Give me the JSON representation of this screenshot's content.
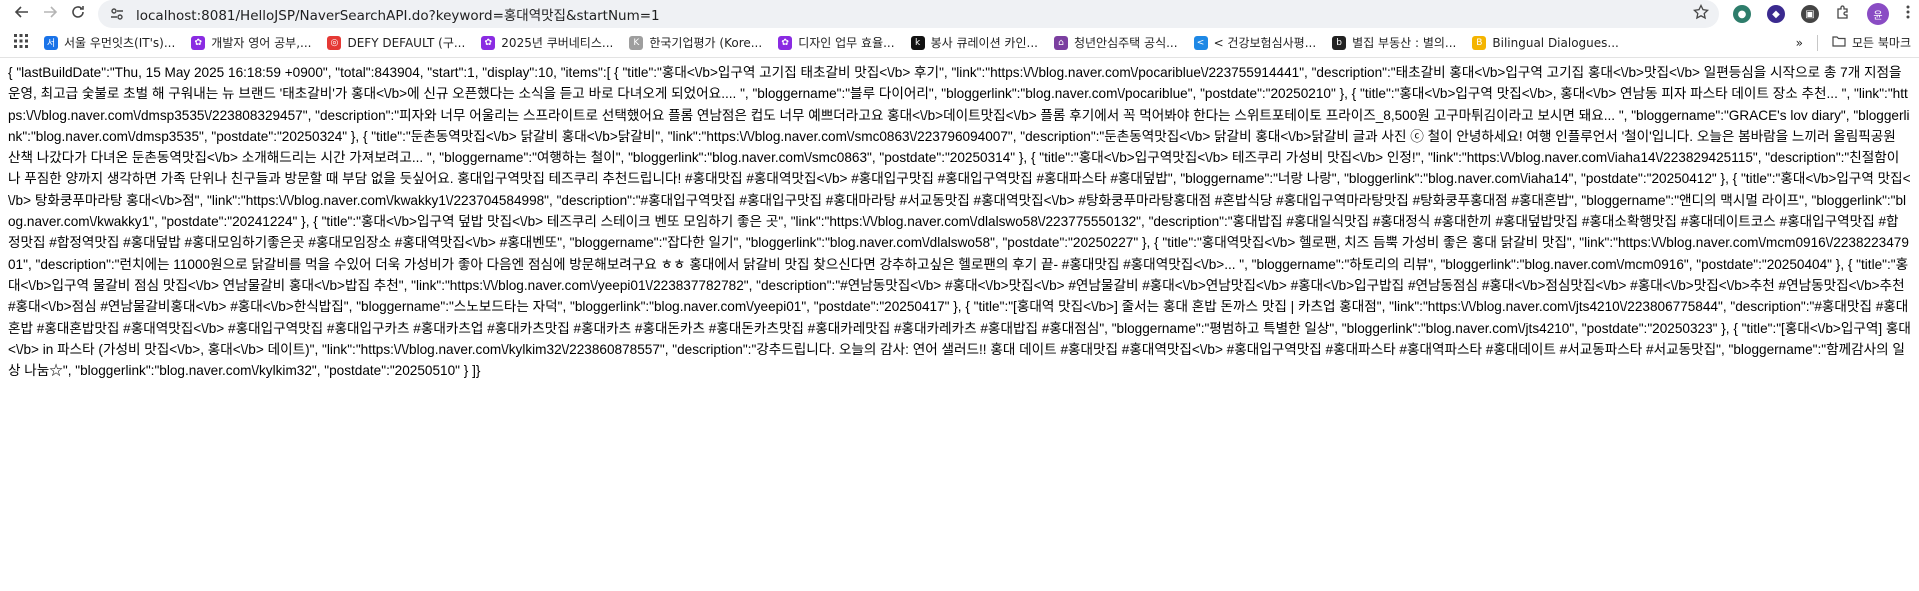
{
  "browser": {
    "url": "localhost:8081/HelloJSP/NaverSearchAPI.do?keyword=홍대역맛집&startNum=1",
    "profile_initial": "윤"
  },
  "bookmarks": [
    {
      "label": "서울 우먼잇츠(IT's)...",
      "icon_color": "#1a73e8",
      "icon": "서"
    },
    {
      "label": "개발자 영어 공부,...",
      "icon_color": "#8a2be2",
      "icon": "✿"
    },
    {
      "label": "DEFY DEFAULT (구...",
      "icon_color": "#e53935",
      "icon": "◎"
    },
    {
      "label": "2025년 쿠버네티스...",
      "icon_color": "#8a2be2",
      "icon": "✿"
    },
    {
      "label": "한국기업평가 (Kore...",
      "icon_color": "#9e9e9e",
      "icon": "K"
    },
    {
      "label": "디자인 업무 효율...",
      "icon_color": "#8a2be2",
      "icon": "✿"
    },
    {
      "label": "봉사 큐레이션 카인...",
      "icon_color": "#111111",
      "icon": "k"
    },
    {
      "label": "청년안심주택 공식...",
      "icon_color": "#7b3fa0",
      "icon": "⌂"
    },
    {
      "label": "< 건강보험심사평...",
      "icon_color": "#1e88e5",
      "icon": "<"
    },
    {
      "label": "별집 부동산 : 별의...",
      "icon_color": "#222222",
      "icon": "b"
    },
    {
      "label": "Bilingual Dialogues...",
      "icon_color": "#f4b400",
      "icon": "B"
    }
  ],
  "bookmarks_folder": "모든 북마크",
  "json_text": "{ \"lastBuildDate\":\"Thu, 15 May 2025 16:18:59 +0900\", \"total\":843904, \"start\":1, \"display\":10, \"items\":[ { \"title\":\"홍대<\\/b>입구역 고기집 태초갈비 맛집<\\/b> 후기\", \"link\":\"https:\\/\\/blog.naver.com\\/pocariblue\\/223755914441\", \"description\":\"태초갈비 홍대<\\/b>입구역 고기집 홍대<\\/b>맛집<\\/b> 일편등심을 시작으로 총 7개 지점을 운영, 최고급 숯불로 초벌 해 구워내는 뉴 브랜드 '태초갈비'가 홍대<\\/b>에 신규 오픈했다는 소식을 듣고 바로 다녀오게 되었어요.... \", \"bloggername\":\"블루 다이어리\", \"bloggerlink\":\"blog.naver.com\\/pocariblue\", \"postdate\":\"20250210\" }, { \"title\":\"홍대<\\/b>입구역 맛집<\\/b>, 홍대<\\/b> 연남동 피자 파스타 데이트 장소 추천... \", \"link\":\"https:\\/\\/blog.naver.com\\/dmsp3535\\/223808329457\", \"description\":\"피자와 너무 어울리는 스프라이트로 선택했어요 플롬 연남점은 컵도 너무 예쁘더라고요 홍대<\\/b>데이트맛집<\\/b> 플롬 후기에서 꼭 먹어봐야 한다는 스위트포테이토 프라이즈_8,500원 고구마튀김이라고 보시면 돼요... \", \"bloggername\":\"GRACE's lov diary\", \"bloggerlink\":\"blog.naver.com\\/dmsp3535\", \"postdate\":\"20250324\" }, { \"title\":\"둔촌동역맛집<\\/b> 닭갈비 홍대<\\/b>닭갈비\", \"link\":\"https:\\/\\/blog.naver.com\\/smc0863\\/223796094007\", \"description\":\"둔촌동역맛집<\\/b> 닭갈비 홍대<\\/b>닭갈비 글과 사진 ⓒ 철이 안녕하세요! 여행 인플루언서 '철이'입니다. 오늘은 봄바람을 느끼러 올림픽공원 산책 나갔다가 다녀온 둔촌동역맛집<\\/b> 소개해드리는 시간 가져보려고... \", \"bloggername\":\"여행하는 철이\", \"bloggerlink\":\"blog.naver.com\\/smc0863\", \"postdate\":\"20250314\" }, { \"title\":\"홍대<\\/b>입구역맛집<\\/b> 테즈쿠리 가성비 맛집<\\/b> 인정!\", \"link\":\"https:\\/\\/blog.naver.com\\/iaha14\\/223829425115\", \"description\":\"친절함이나 푸짐한 양까지 생각하면 가족 단위나 친구들과 방문할 때 부담 없을 듯싶어요. 홍대입구역맛집 테즈쿠리 추천드립니다! #홍대맛집 #홍대역맛집<\\/b> #홍대입구맛집 #홍대입구역맛집 #홍대파스타 #홍대덮밥\", \"bloggername\":\"너랑 나랑\", \"bloggerlink\":\"blog.naver.com\\/iaha14\", \"postdate\":\"20250412\" }, { \"title\":\"홍대<\\/b>입구역 맛집<\\/b> 탕화쿵푸마라탕 홍대<\\/b>점\", \"link\":\"https:\\/\\/blog.naver.com\\/kwakky1\\/223704584998\", \"description\":\"#홍대입구역맛집 #홍대입구맛집 #홍대마라탕 #서교동맛집 #홍대역맛집<\\/b> #탕화쿵푸마라탕홍대점 #혼밥식당 #홍대입구역마라탕맛집 #탕화쿵푸홍대점 #홍대혼밥\", \"bloggername\":\"앤디의 맥시멀 라이프\", \"bloggerlink\":\"blog.naver.com\\/kwakky1\", \"postdate\":\"20241224\" }, { \"title\":\"홍대<\\/b>입구역 덮밥 맛집<\\/b> 테즈쿠리 스테이크 벤또 모임하기 좋은 곳\", \"link\":\"https:\\/\\/blog.naver.com\\/dlalswo58\\/223775550132\", \"description\":\"홍대밥집 #홍대일식맛집 #홍대정식 #홍대한끼 #홍대덮밥맛집 #홍대소확행맛집 #홍대데이트코스 #홍대입구역맛집 #합정맛집 #합정역맛집 #홍대덮밥 #홍대모임하기좋은곳 #홍대모임장소 #홍대역맛집<\\/b> #홍대벤또\", \"bloggername\":\"잡다한 일기\", \"bloggerlink\":\"blog.naver.com\\/dlalswo58\", \"postdate\":\"20250227\" }, { \"title\":\"홍대역맛집<\\/b> 헬로팬, 치즈 듬뿍 가성비 좋은 홍대 닭갈비 맛집\", \"link\":\"https:\\/\\/blog.naver.com\\/mcm0916\\/223822347901\", \"description\":\"런치에는 11000원으로 닭갈비를 먹을 수있어 더욱 가성비가 좋아 다음엔 점심에 방문해보려구요 ㅎㅎ 홍대에서 닭갈비 맛집 찾으신다면 강추하고싶은 헬로팬의 후기 끝- #홍대맛집 #홍대역맛집<\\/b>... \", \"bloggername\":\"하토리의 리뷰\", \"bloggerlink\":\"blog.naver.com\\/mcm0916\", \"postdate\":\"20250404\" }, { \"title\":\"홍대<\\/b>입구역 물갈비 점심 맛집<\\/b> 연남물갈비 홍대<\\/b>밥집 추천\", \"link\":\"https:\\/\\/blog.naver.com\\/yeepi01\\/223837782782\", \"description\":\"#연남동맛집<\\/b> #홍대<\\/b>맛집<\\/b> #연남물갈비 #홍대<\\/b>연남맛집<\\/b> #홍대<\\/b>입구밥집 #연남동점심 #홍대<\\/b>점심맛집<\\/b> #홍대<\\/b>맛집<\\/b>추천 #연남동맛집<\\/b>추천 #홍대<\\/b>점심 #연남물갈비홍대<\\/b> #홍대<\\/b>한식밥집\", \"bloggername\":\"스노보드타는 자덕\", \"bloggerlink\":\"blog.naver.com\\/yeepi01\", \"postdate\":\"20250417\" }, { \"title\":\"[홍대역 맛집<\\/b>] 줄서는 홍대 혼밥 돈까스 맛집 | 카츠업 홍대점\", \"link\":\"https:\\/\\/blog.naver.com\\/jts4210\\/223806775844\", \"description\":\"#홍대맛집 #홍대혼밥 #홍대혼밥맛집 #홍대역맛집<\\/b> #홍대입구역맛집 #홍대입구카츠 #홍대카츠업 #홍대카츠맛집 #홍대카츠 #홍대돈카츠 #홍대돈카츠맛집 #홍대카레맛집 #홍대카레카츠 #홍대밥집 #홍대점심\", \"bloggername\":\"평범하고 특별한 일상\", \"bloggerlink\":\"blog.naver.com\\/jts4210\", \"postdate\":\"20250323\" }, { \"title\":\"[홍대<\\/b>입구역] 홍대<\\/b> in 파스타 (가성비 맛집<\\/b>, 홍대<\\/b> 데이트)\", \"link\":\"https:\\/\\/blog.naver.com\\/kylkim32\\/223860878557\", \"description\":\"강추드립니다. 오늘의 감사: 연어 샐러드!! 홍대 데이트 #홍대맛집 #홍대역맛집<\\/b> #홍대입구역맛집 #홍대파스타 #홍대역파스타 #홍대데이트 #서교동파스타 #서교동맛집\", \"bloggername\":\"함께감사의 일상 나눔☆\", \"bloggerlink\":\"blog.naver.com\\/kylkim32\", \"postdate\":\"20250510\" } ]}"
}
